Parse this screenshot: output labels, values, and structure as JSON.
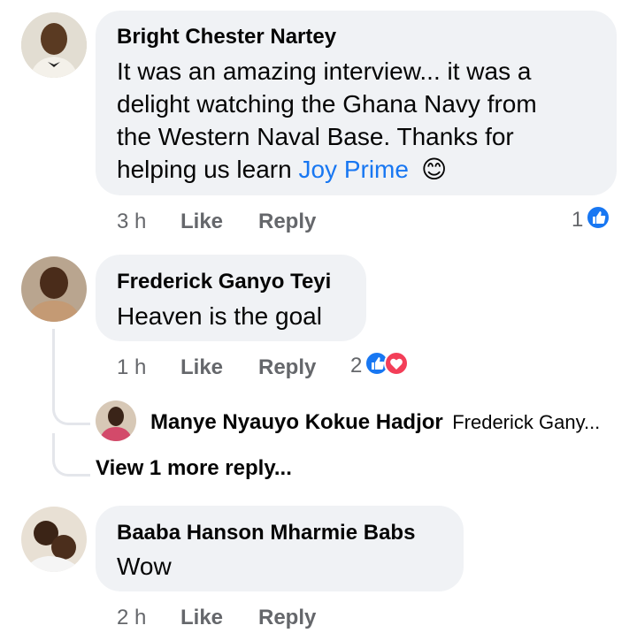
{
  "comments": [
    {
      "author": "Bright Chester Nartey",
      "text_lines": [
        "It was an amazing interview... it was a",
        "delight watching the Ghana Navy from",
        "the Western Naval Base. Thanks for"
      ],
      "text_last": "helping us learn ",
      "mention": "Joy Prime",
      "emoji": "😊",
      "time": "3 h",
      "like_label": "Like",
      "reply_label": "Reply",
      "reaction_count": "1",
      "reactions": [
        "like-icon"
      ]
    },
    {
      "author": "Frederick Ganyo Teyi",
      "text": "Heaven is the goal",
      "time": "1 h",
      "like_label": "Like",
      "reply_label": "Reply",
      "reaction_count": "2",
      "reactions": [
        "like-icon",
        "love-icon"
      ],
      "reply_preview": {
        "author": "Manye Nyauyo Kokue Hadjor",
        "snippet": "Frederick Gany..."
      },
      "view_more": "View 1 more reply..."
    },
    {
      "author": "Baaba Hanson Mharmie Babs",
      "text": "Wow",
      "time": "2 h",
      "like_label": "Like",
      "reply_label": "Reply"
    }
  ],
  "colors": {
    "bubble": "#f0f2f5",
    "mention": "#1877f2",
    "meta": "#65676b",
    "like": "#1877f2",
    "love": "#f33e58"
  }
}
